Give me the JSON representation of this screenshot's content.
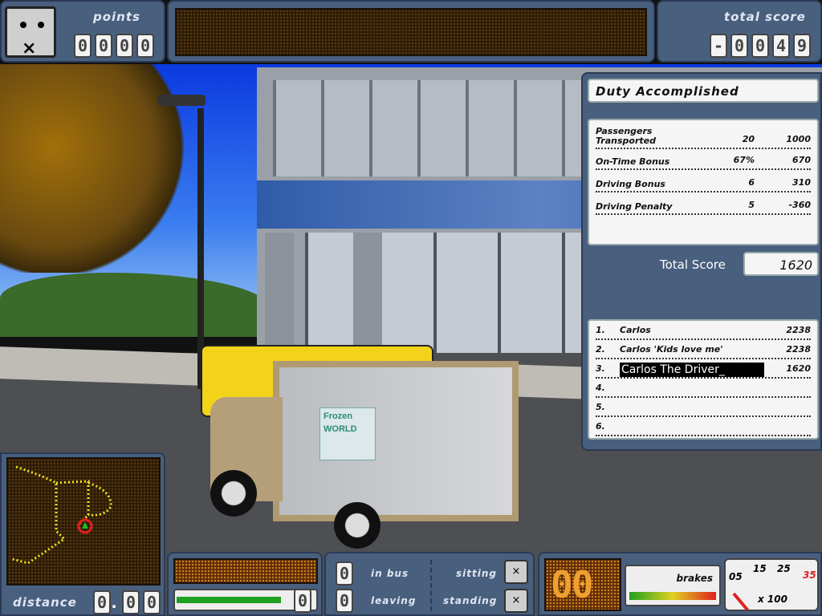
{
  "hud": {
    "points": {
      "label": "points",
      "digits": [
        "0",
        "0",
        "0",
        "0"
      ]
    },
    "total_score": {
      "label": "total score",
      "digits": [
        "-",
        "0",
        "0",
        "4",
        "9"
      ]
    },
    "distance": {
      "label": "distance",
      "digits": [
        "0",
        ".",
        "0",
        "0"
      ]
    },
    "speed_bar_value": "0",
    "passengers": {
      "in_bus": {
        "count": "0",
        "label": "in bus"
      },
      "leaving": {
        "count": "0",
        "label": "leaving"
      },
      "sitting_label": "sitting",
      "standing_label": "standing"
    },
    "gear_display": "00",
    "brakes_label": "brakes",
    "speedometer": {
      "ticks": [
        "05",
        "15",
        "25",
        "35"
      ],
      "unit": "x 100"
    }
  },
  "results": {
    "title": "Duty Accomplished",
    "rows": [
      {
        "label": "Passengers Transported",
        "count": "20",
        "points": "1000"
      },
      {
        "label": "On-Time Bonus",
        "count": "67%",
        "points": "670"
      },
      {
        "label": "Driving Bonus",
        "count": "6",
        "points": "310"
      },
      {
        "label": "Driving Penalty",
        "count": "5",
        "points": "-360"
      }
    ],
    "total_label": "Total Score",
    "total_value": "1620"
  },
  "highscores": [
    {
      "rank": "1.",
      "name": "Carlos",
      "score": "2238"
    },
    {
      "rank": "2.",
      "name": "Carlos 'Kids love me'",
      "score": "2238"
    },
    {
      "rank": "3.",
      "name": "Carlos The Driver_",
      "score": "1620"
    },
    {
      "rank": "4.",
      "name": "",
      "score": ""
    },
    {
      "rank": "5.",
      "name": "",
      "score": ""
    },
    {
      "rank": "6.",
      "name": "",
      "score": ""
    }
  ],
  "scene": {
    "truck_logo_line1": "Frozen",
    "truck_logo_line2": "WORLD"
  },
  "colors": {
    "panel": "#495f7e",
    "lcd": "#2a1a06",
    "accent_red": "#e02020",
    "map_route": "#f0e020"
  }
}
